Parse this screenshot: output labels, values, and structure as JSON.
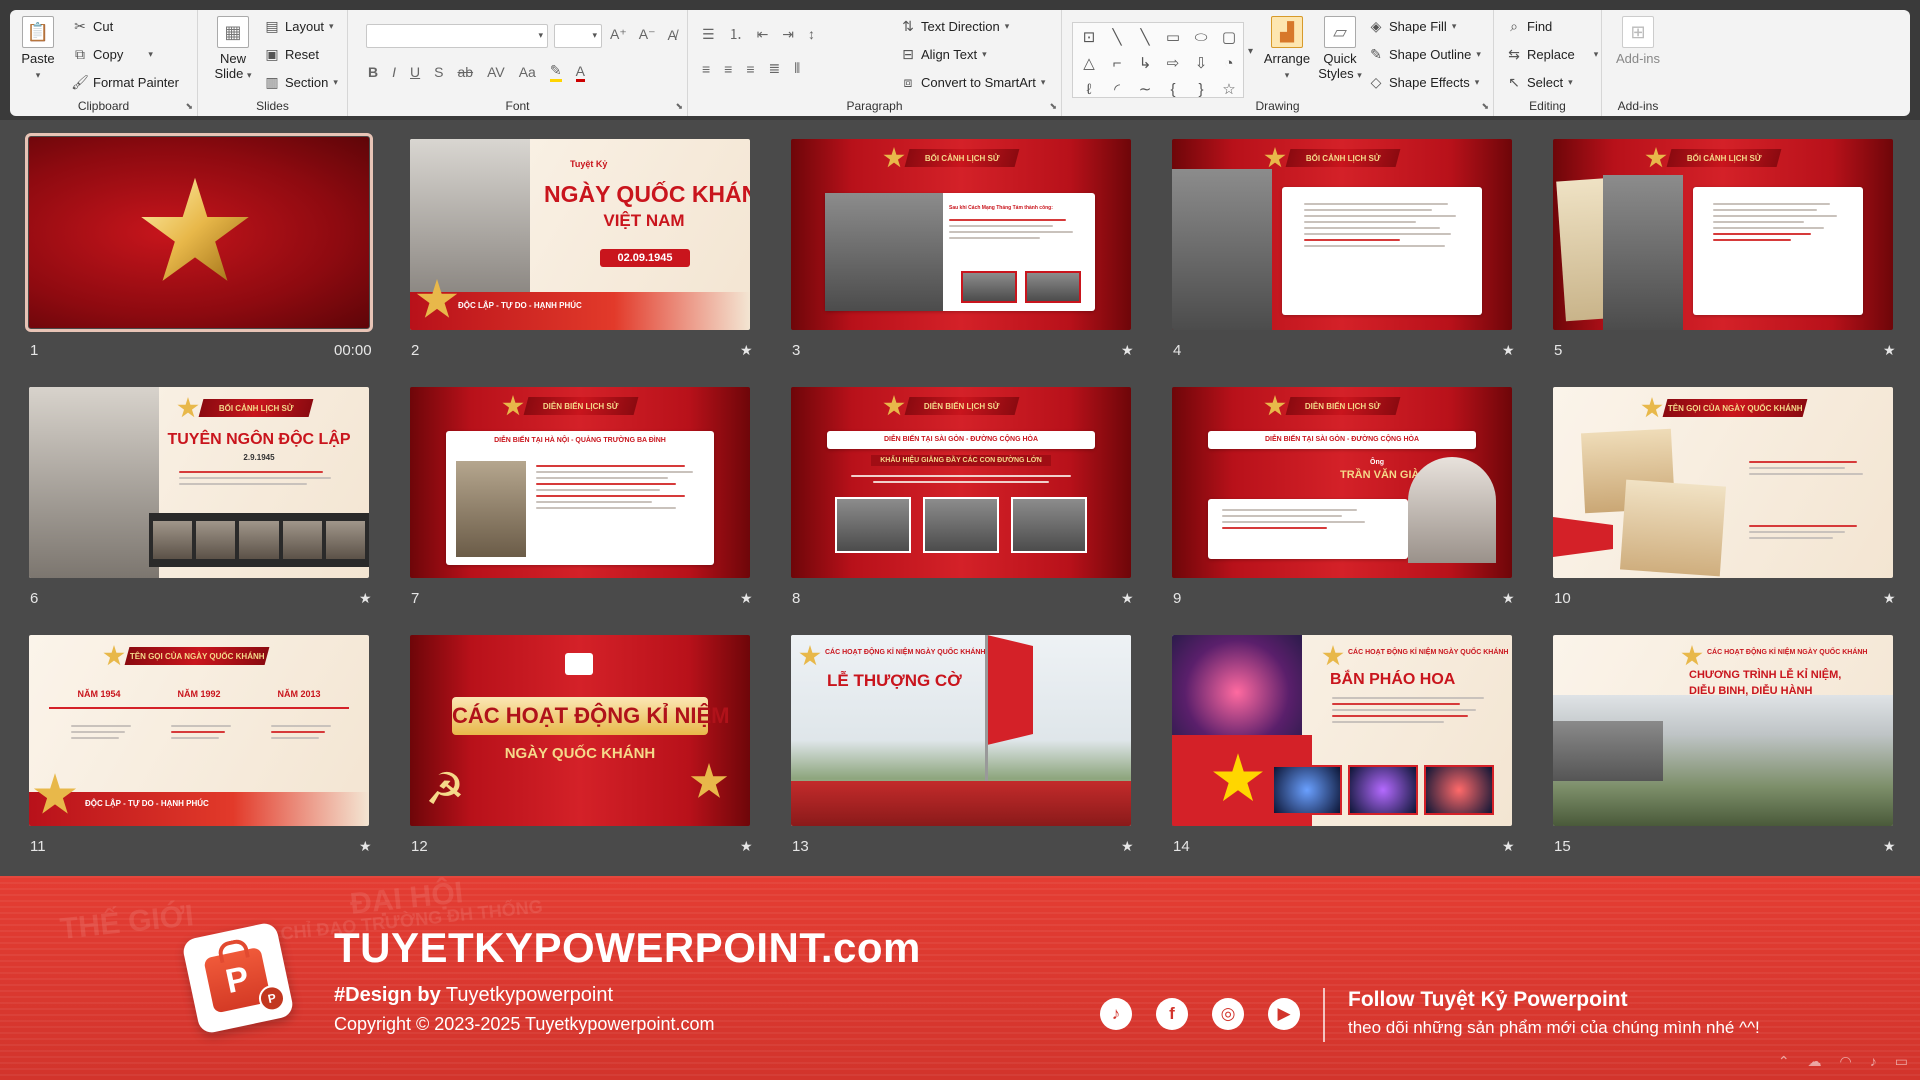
{
  "ribbon": {
    "clipboard": {
      "label": "Clipboard",
      "paste": "Paste",
      "cut": "Cut",
      "copy": "Copy",
      "format_painter": "Format Painter"
    },
    "slides": {
      "label": "Slides",
      "new_slide": "New Slide",
      "layout": "Layout",
      "reset": "Reset",
      "section": "Section"
    },
    "font": {
      "label": "Font"
    },
    "paragraph": {
      "label": "Paragraph",
      "text_direction": "Text Direction",
      "align_text": "Align Text",
      "convert_smartart": "Convert to SmartArt"
    },
    "drawing": {
      "label": "Drawing",
      "arrange": "Arrange",
      "quick_styles": "Quick Styles",
      "shape_fill": "Shape Fill",
      "shape_outline": "Shape Outline",
      "shape_effects": "Shape Effects"
    },
    "editing": {
      "label": "Editing",
      "find": "Find",
      "replace": "Replace",
      "select": "Select"
    },
    "addins": {
      "label": "Add-ins",
      "addins_btn": "Add-ins"
    }
  },
  "slides": [
    {
      "number": "1",
      "time": "00:00"
    },
    {
      "number": "2",
      "title": "NGÀY QUỐC KHÁNH",
      "subtitle": "VIỆT NAM",
      "date": "02.09.1945",
      "motto": "ĐỘC LẬP - TỰ DO - HẠNH PHÚC",
      "brand": "Tuyệt Kỷ"
    },
    {
      "number": "3",
      "banner": "BỐI CẢNH LỊCH SỬ",
      "heading": "Sau khi Cách Mạng Tháng Tám thành công:"
    },
    {
      "number": "4",
      "banner": "BỐI CẢNH LỊCH SỬ"
    },
    {
      "number": "5",
      "banner": "BỐI CẢNH LỊCH SỬ"
    },
    {
      "number": "6",
      "banner": "BỐI CẢNH LỊCH SỬ",
      "title": "TUYÊN NGÔN ĐỘC LẬP",
      "date": "2.9.1945"
    },
    {
      "number": "7",
      "banner": "DIỄN BIẾN LỊCH SỬ",
      "heading": "DIỄN BIẾN TẠI HÀ NỘI - QUẢNG TRƯỜNG BA ĐÌNH"
    },
    {
      "number": "8",
      "banner": "DIỄN BIẾN LỊCH SỬ",
      "heading": "DIỄN BIẾN TẠI SÀI GÒN - ĐƯỜNG CỘNG HÒA",
      "slogan": "KHẨU HIỆU GIĂNG ĐẦY CÁC CON ĐƯỜNG LỚN"
    },
    {
      "number": "9",
      "banner": "DIỄN BIẾN LỊCH SỬ",
      "heading": "DIỄN BIẾN TẠI SÀI GÒN - ĐƯỜNG CỘNG HÒA",
      "name_prefix": "Ông",
      "name": "TRẦN VĂN GIÀU"
    },
    {
      "number": "10",
      "banner": "TÊN GỌI CỦA NGÀY QUỐC KHÁNH"
    },
    {
      "number": "11",
      "banner": "TÊN GỌI CỦA NGÀY QUỐC KHÁNH",
      "years": [
        "NĂM 1954",
        "NĂM 1992",
        "NĂM 2013"
      ],
      "motto": "ĐỘC LẬP - TỰ DO - HẠNH PHÚC"
    },
    {
      "number": "12",
      "title": "CÁC HOẠT ĐỘNG KỈ NIỆM",
      "subtitle": "NGÀY QUỐC KHÁNH"
    },
    {
      "number": "13",
      "banner": "CÁC HOẠT ĐỘNG KỈ NIỆM NGÀY QUỐC KHÁNH",
      "title": "LỄ THƯỢNG CỜ"
    },
    {
      "number": "14",
      "banner": "CÁC HOẠT ĐỘNG KỈ NIỆM NGÀY QUỐC KHÁNH",
      "title": "BẮN PHÁO HOA"
    },
    {
      "number": "15",
      "banner": "CÁC HOẠT ĐỘNG KỈ NIỆM NGÀY QUỐC KHÁNH",
      "title": "CHƯƠNG TRÌNH LỄ KỈ NIỆM,",
      "title2": "DIỄU BINH, DIỄU HÀNH"
    }
  ],
  "footer": {
    "site": "TUYETKYPOWERPOINT.com",
    "design_prefix": "#Design by",
    "design_by": "Tuyetkypowerpoint",
    "copyright": "Copyright © 2023-2025 Tuyetkypowerpoint.com",
    "follow_title": "Follow Tuyệt Kỷ Powerpoint",
    "follow_sub": "theo dõi những sản phẩm mới của chúng mình nhé ^^!",
    "social": [
      {
        "name": "tiktok-icon",
        "glyph": "♪"
      },
      {
        "name": "facebook-icon",
        "glyph": "f"
      },
      {
        "name": "instagram-icon",
        "glyph": "◎"
      },
      {
        "name": "youtube-icon",
        "glyph": "▶"
      }
    ],
    "ghost_text": [
      "ĐẠI HỘI",
      "THẾ GIỚI",
      "CHỈ ĐẠO TRƯỜNG ĐH THỐNG"
    ]
  },
  "colors": {
    "accent_red": "#d42128",
    "gold": "#e8b84a",
    "ribbon_bg": "#f3f3f3",
    "sorter_bg": "#4a4a4a",
    "footer_red": "#e43d33"
  }
}
